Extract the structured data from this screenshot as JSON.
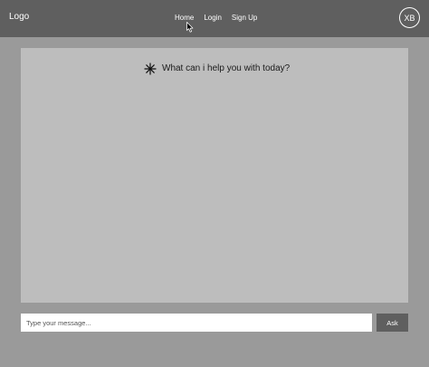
{
  "navbar": {
    "logo": "Logo",
    "links": [
      "Home",
      "Login",
      "Sign Up"
    ],
    "avatar_initials": "XB"
  },
  "chat": {
    "greeting_icon": "asterisk-sparkle-icon",
    "greeting": "What can i help you with today?"
  },
  "composer": {
    "input_placeholder": "Type your message...",
    "input_value": "",
    "ask_label": "Ask"
  },
  "colors": {
    "page_background": "#9a9a9a",
    "navbar": "#5f5f5f",
    "chat_panel": "#bdbdbd",
    "button": "#5f5f5f"
  }
}
